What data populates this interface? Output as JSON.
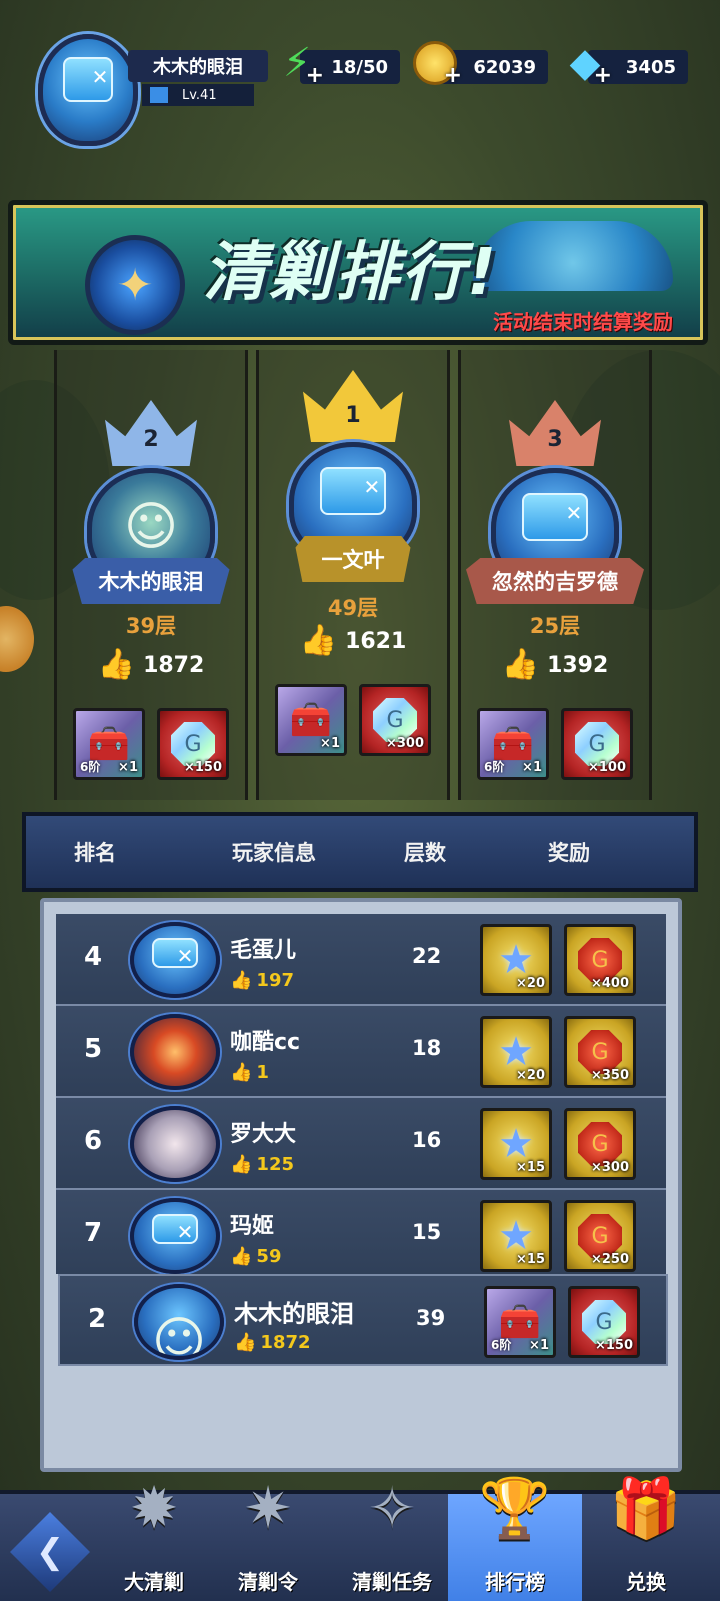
{
  "header": {
    "player_name": "木木的眼泪",
    "player_level": "Lv.41",
    "energy": "18/50",
    "coins": "62039",
    "gems": "3405"
  },
  "banner": {
    "title": "清剿排行!",
    "subtitle": "活动结束时结算奖励"
  },
  "podium": [
    {
      "rank": "2",
      "name": "木木的眼泪",
      "floors": "39层",
      "likes": "1872",
      "rewards": [
        {
          "tier": "6阶",
          "count": "×1"
        },
        {
          "count": "×150"
        }
      ]
    },
    {
      "rank": "1",
      "name": "一文叶",
      "floors": "49层",
      "likes": "1621",
      "rewards": [
        {
          "tier": "",
          "count": "×1"
        },
        {
          "count": "×300"
        }
      ]
    },
    {
      "rank": "3",
      "name": "忽然的吉罗德",
      "floors": "25层",
      "likes": "1392",
      "rewards": [
        {
          "tier": "6阶",
          "count": "×1"
        },
        {
          "count": "×100"
        }
      ]
    }
  ],
  "table": {
    "headers": {
      "rank": "排名",
      "player": "玩家信息",
      "floors": "层数",
      "reward": "奖励"
    },
    "rows": [
      {
        "rank": "4",
        "name": "毛蛋儿",
        "likes": "197",
        "floors": "22",
        "r1": "×20",
        "r2": "×400"
      },
      {
        "rank": "5",
        "name": "咖酷cc",
        "likes": "1",
        "floors": "18",
        "r1": "×20",
        "r2": "×350"
      },
      {
        "rank": "6",
        "name": "罗大大",
        "likes": "125",
        "floors": "16",
        "r1": "×15",
        "r2": "×300"
      },
      {
        "rank": "7",
        "name": "玛姬",
        "likes": "59",
        "floors": "15",
        "r1": "×15",
        "r2": "×250"
      }
    ],
    "me": {
      "rank": "2",
      "name": "木木的眼泪",
      "likes": "1872",
      "floors": "39",
      "tier": "6阶",
      "r1": "×1",
      "r2": "×150"
    }
  },
  "nav": {
    "items": [
      "大清剿",
      "清剿令",
      "清剿任务",
      "排行榜",
      "兑换"
    ],
    "active": "排行榜"
  }
}
